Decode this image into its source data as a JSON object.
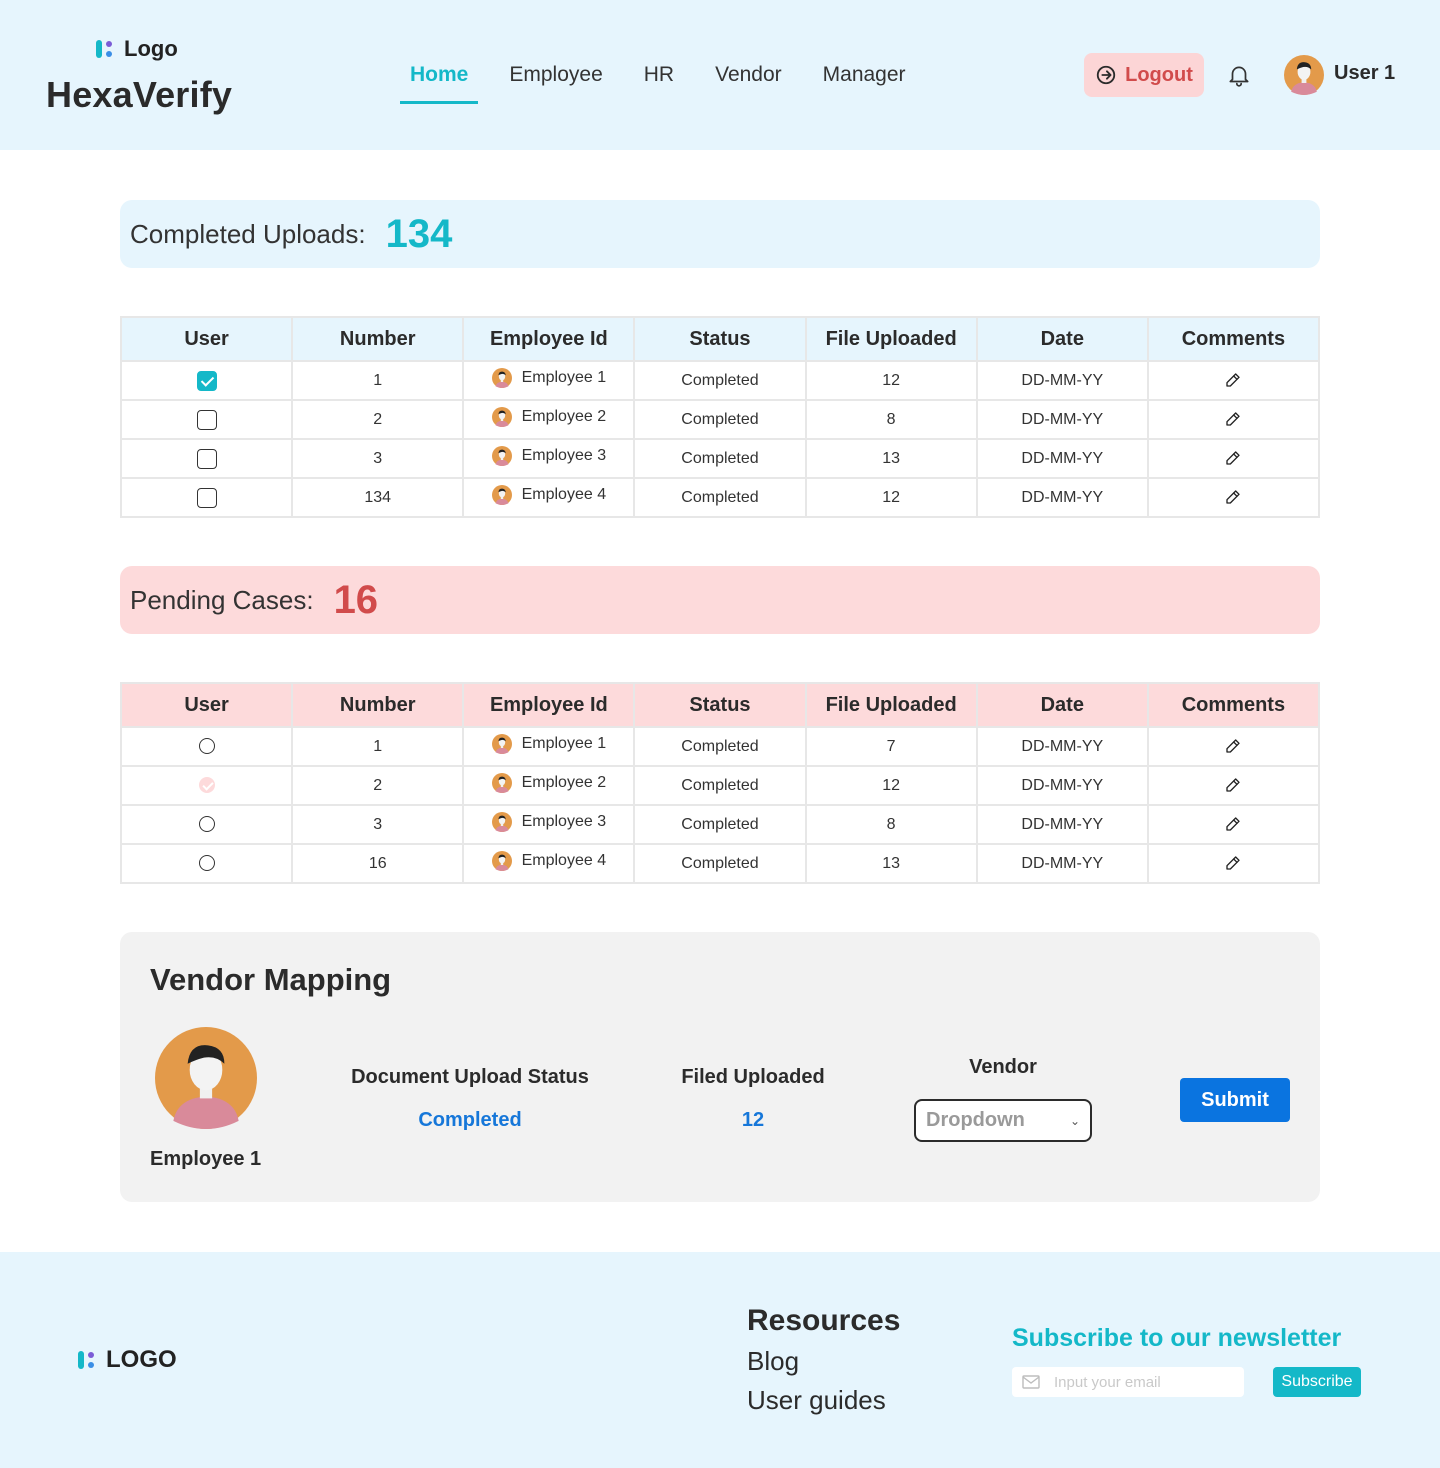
{
  "header": {
    "logo_text": "Logo",
    "brand": "HexaVerify",
    "nav": [
      {
        "label": "Home",
        "active": true
      },
      {
        "label": "Employee",
        "active": false
      },
      {
        "label": "HR",
        "active": false
      },
      {
        "label": "Vendor",
        "active": false
      },
      {
        "label": "Manager",
        "active": false
      }
    ],
    "logout_label": "Logout",
    "user_name": "User 1"
  },
  "completed": {
    "label": "Completed Uploads:",
    "value": "134",
    "columns": [
      "User",
      "Number",
      "Employee Id",
      "Status",
      "File Uploaded",
      "Date",
      "Comments"
    ],
    "rows": [
      {
        "checked": true,
        "number": "1",
        "employee": "Employee 1",
        "status": "Completed",
        "files": "12",
        "date": "DD-MM-YY"
      },
      {
        "checked": false,
        "number": "2",
        "employee": "Employee 2",
        "status": "Completed",
        "files": "8",
        "date": "DD-MM-YY"
      },
      {
        "checked": false,
        "number": "3",
        "employee": "Employee 3",
        "status": "Completed",
        "files": "13",
        "date": "DD-MM-YY"
      },
      {
        "checked": false,
        "number": "134",
        "employee": "Employee 4",
        "status": "Completed",
        "files": "12",
        "date": "DD-MM-YY"
      }
    ]
  },
  "pending": {
    "label": "Pending Cases:",
    "value": "16",
    "columns": [
      "User",
      "Number",
      "Employee Id",
      "Status",
      "File Uploaded",
      "Date",
      "Comments"
    ],
    "rows": [
      {
        "checked": false,
        "number": "1",
        "employee": "Employee 1",
        "status": "Completed",
        "files": "7",
        "date": "DD-MM-YY"
      },
      {
        "checked": true,
        "number": "2",
        "employee": "Employee 2",
        "status": "Completed",
        "files": "12",
        "date": "DD-MM-YY"
      },
      {
        "checked": false,
        "number": "3",
        "employee": "Employee 3",
        "status": "Completed",
        "files": "8",
        "date": "DD-MM-YY"
      },
      {
        "checked": false,
        "number": "16",
        "employee": "Employee 4",
        "status": "Completed",
        "files": "13",
        "date": "DD-MM-YY"
      }
    ]
  },
  "vendor_mapping": {
    "title": "Vendor Mapping",
    "employee": "Employee 1",
    "doc_status_label": "Document Upload Status",
    "doc_status_value": "Completed",
    "filed_label": "Filed Uploaded",
    "filed_value": "12",
    "vendor_label": "Vendor",
    "dropdown_value": "Dropdown",
    "submit_label": "Submit"
  },
  "footer": {
    "logo_text": "LOGO",
    "resources_title": "Resources",
    "links": [
      "Blog",
      "User guides"
    ],
    "newsletter_title": "Subscribe to our newsletter",
    "email_placeholder": "Input your email",
    "subscribe_label": "Subscribe"
  },
  "colors": {
    "accent": "#14b8c8",
    "danger": "#d14b4b",
    "primary": "#0a74e0",
    "header_bg": "#e6f5fd",
    "pending_bg": "#fddadb"
  },
  "icons": [
    "logo-mark-icon",
    "logout-icon",
    "bell-icon",
    "avatar-icon",
    "edit-icon",
    "chevron-down-icon",
    "mail-icon"
  ]
}
